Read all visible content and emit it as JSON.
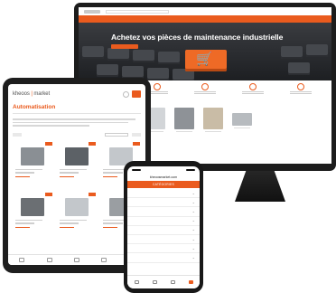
{
  "colors": {
    "accent": "#ea5b1e",
    "device_frame": "#1c1c1c"
  },
  "monitor": {
    "hero": {
      "title": "Achetez vos pièces de maintenance industrielle"
    }
  },
  "tablet": {
    "logo": {
      "primary": "kheoos",
      "separator": " | ",
      "secondary": "market"
    },
    "page_title": "Automatisation"
  },
  "phone": {
    "url": "kheoosmarket.com",
    "categories_label": "CATÉGORIES"
  },
  "icons": {
    "cart": "shopping-cart-icon",
    "chevron": "chevron-down-icon"
  }
}
